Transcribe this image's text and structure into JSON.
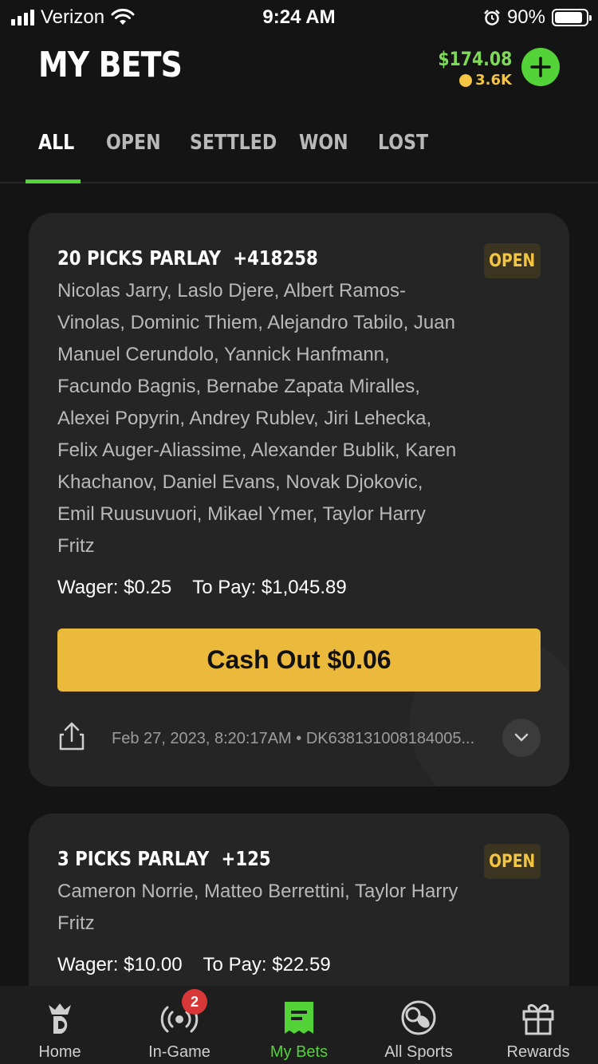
{
  "status_bar": {
    "carrier": "Verizon",
    "time": "9:24 AM",
    "battery_percent": "90%",
    "battery_level": 0.9
  },
  "header": {
    "title": "MY BETS",
    "balance": "$174.08",
    "crowns": "3.6K",
    "add_icon": "plus-icon"
  },
  "tabs": [
    {
      "label": "ALL",
      "active": true
    },
    {
      "label": "OPEN",
      "active": false
    },
    {
      "label": "SETTLED",
      "active": false
    },
    {
      "label": "WON",
      "active": false
    },
    {
      "label": "LOST",
      "active": false
    }
  ],
  "bets": [
    {
      "title": "20 PICKS PARLAY",
      "odds": "+418258",
      "status": "OPEN",
      "legs": "Nicolas Jarry, Laslo Djere, Albert Ramos-Vinolas, Dominic Thiem, Alejandro Tabilo, Juan Manuel Cerundolo, Yannick Hanfmann, Facundo Bagnis, Bernabe Zapata Miralles, Alexei Popyrin, Andrey Rublev, Jiri Lehecka, Felix Auger-Aliassime, Alexander Bublik, Karen Khachanov, Daniel Evans, Novak Djokovic, Emil Ruusuvuori, Mikael Ymer, Taylor Harry Fritz",
      "wager": "Wager: $0.25",
      "to_pay": "To Pay: $1,045.89",
      "cash_out": "Cash Out $0.06",
      "meta": "Feb 27, 2023, 8:20:17AM • DK638131008184005..."
    },
    {
      "title": "3 PICKS PARLAY",
      "odds": "+125",
      "status": "OPEN",
      "legs": "Cameron Norrie, Matteo Berrettini, Taylor Harry Fritz",
      "wager": "Wager: $10.00",
      "to_pay": "To Pay: $22.59"
    }
  ],
  "bottom_nav": [
    {
      "label": "Home",
      "icon": "draftkings-logo-icon",
      "active": false
    },
    {
      "label": "In-Game",
      "icon": "live-broadcast-icon",
      "badge": "2",
      "active": false
    },
    {
      "label": "My Bets",
      "icon": "bet-slip-icon",
      "active": true
    },
    {
      "label": "All Sports",
      "icon": "sports-balls-icon",
      "active": false
    },
    {
      "label": "Rewards",
      "icon": "gift-icon",
      "active": false
    }
  ],
  "colors": {
    "accent_green": "#53d337",
    "balance_green": "#7ed957",
    "gold": "#ebb93b",
    "badge_gold": "#f4c542",
    "background": "#141414",
    "card": "#252525"
  }
}
